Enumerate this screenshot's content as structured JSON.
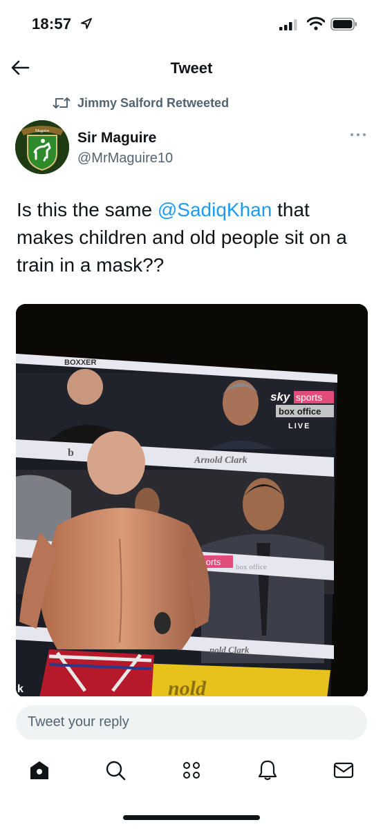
{
  "status_bar": {
    "time": "18:57"
  },
  "header": {
    "title": "Tweet"
  },
  "retweet": {
    "label": "Jimmy Salford Retweeted"
  },
  "author": {
    "name": "Sir Maguire",
    "handle": "@MrMaguire10",
    "avatar_banner": "Maguire"
  },
  "tweet": {
    "text_before": "Is this the same ",
    "mention": "@SadiqKhan",
    "text_after": " that makes children and old people sit on a train in a mask??"
  },
  "media": {
    "overlay_brand": "sky",
    "overlay_sports": "sports",
    "overlay_box_office": "box office",
    "overlay_live": "LIVE",
    "rope_sponsor": "Arnold Clark",
    "lower_banner_sports": "sports",
    "lower_banner_box": "box office",
    "bottom_rope_text": "nold Clark",
    "top_rope_text": "BOXXER",
    "left_banner_fragment": "b",
    "corner_fragment": "k",
    "floor_text": "nold"
  },
  "reply": {
    "placeholder": "Tweet your reply"
  },
  "tabbar": {
    "items": [
      {
        "icon": "home-icon"
      },
      {
        "icon": "search-icon"
      },
      {
        "icon": "spaces-icon"
      },
      {
        "icon": "notifications-icon"
      },
      {
        "icon": "messages-icon"
      }
    ]
  },
  "colors": {
    "accent": "#1d9bf0",
    "secondary_text": "#536471",
    "reply_box": "#eff3f4"
  }
}
